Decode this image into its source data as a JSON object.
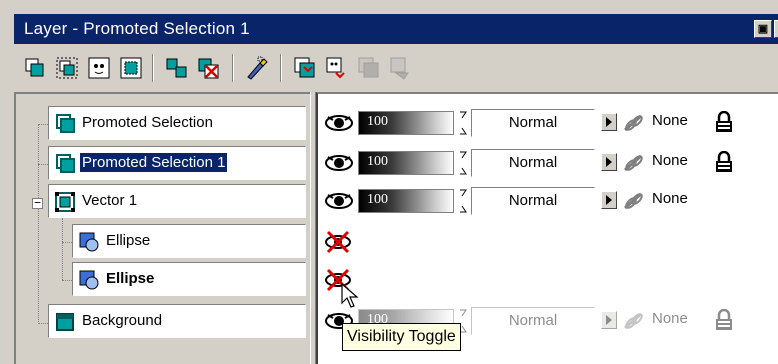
{
  "window": {
    "title": "Layer - Promoted Selection 1"
  },
  "toolbar": {
    "buttons": [
      {
        "name": "new-layer-icon"
      },
      {
        "name": "new-group-icon"
      },
      {
        "name": "new-mask-icon"
      },
      {
        "name": "new-selection-layer-icon"
      },
      {
        "name": "duplicate-layer-icon"
      },
      {
        "name": "delete-layer-icon"
      },
      {
        "name": "layer-properties-icon"
      },
      {
        "name": "merge-down-icon"
      },
      {
        "name": "merge-visible-icon"
      },
      {
        "name": "merge-all-icon"
      },
      {
        "name": "flatten-icon"
      }
    ]
  },
  "layers": [
    {
      "name": "Promoted Selection",
      "opacity": "100",
      "blend": "Normal",
      "link": "None",
      "locked": true,
      "visible": true,
      "selected": false,
      "bold": false
    },
    {
      "name": "Promoted Selection 1",
      "opacity": "100",
      "blend": "Normal",
      "link": "None",
      "locked": true,
      "visible": true,
      "selected": true,
      "bold": false
    },
    {
      "name": "Vector 1",
      "opacity": "100",
      "blend": "Normal",
      "link": "None",
      "locked": false,
      "visible": true,
      "selected": false,
      "bold": false
    },
    {
      "name": "Ellipse",
      "visible": false,
      "bold": false
    },
    {
      "name": "Ellipse",
      "visible": false,
      "bold": true
    },
    {
      "name": "Background",
      "opacity": "100",
      "blend": "Normal",
      "link": "None",
      "locked": true,
      "visible": true,
      "disabled": true,
      "bold": false
    }
  ],
  "tooltip": {
    "text": "Visibility Toggle"
  },
  "colors": {
    "title_bg": "#0a246a",
    "panel": "#d4d0c8",
    "selection": "#0a246a"
  }
}
